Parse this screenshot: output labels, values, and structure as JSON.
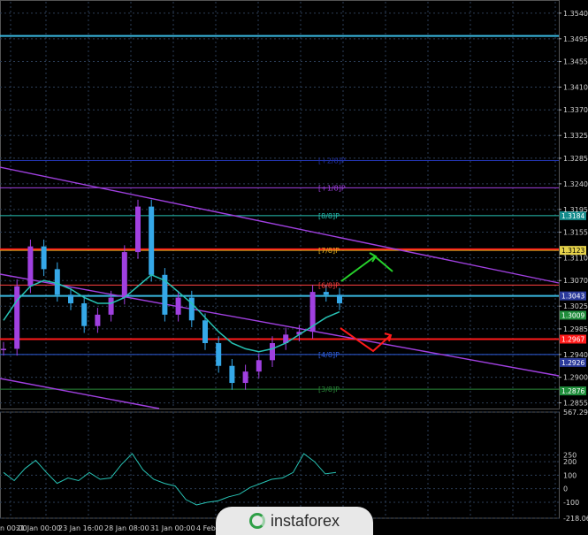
{
  "watermark": {
    "text": "instaforex"
  },
  "colors": {
    "bg": "#000000",
    "grid": "#2c3e57",
    "candle": "#35a8e8",
    "candle_bull": "#a040e0",
    "ma": "#27c2b4",
    "channel": "#a040e0",
    "red_level": "#ff1a1a",
    "cyan_level": "#39b8e0",
    "lbl_bg_blue": "#2b3a9b",
    "lbl_bg_red": "#ff1a1a",
    "lbl_bg_yellow": "#e6d24a",
    "lbl_bg_green": "#1f8d3b",
    "lbl_bg_purple": "#7b2fb0",
    "lbl_bg_teal": "#138c8c",
    "cci": "#27c2b4",
    "arrow_up": "#26d12b",
    "arrow_down": "#ff1a1a"
  },
  "chart_data": [
    {
      "type": "line",
      "title": "",
      "x_ticks": [
        "20 Jan 00:00",
        "21 Jan 00:00",
        "23 Jan 16:00",
        "28 Jan 08:00",
        "31 Jan 00:00",
        "4 Feb"
      ],
      "y_ticks": [
        "1.3540",
        "1.3495",
        "1.3455",
        "1.3410",
        "1.3370",
        "1.3325",
        "1.3285",
        "1.3240",
        "1.3195",
        "1.3155",
        "1.3110",
        "1.3070",
        "1.3025",
        "1.2985",
        "1.2940",
        "1.2900",
        "1.2855"
      ],
      "ylim": [
        1.2845,
        1.356
      ],
      "series": [
        {
          "values": [
            1.295,
            1.306,
            1.313,
            1.309,
            1.3045,
            1.303,
            1.299,
            1.301,
            1.304,
            1.312,
            1.32,
            1.308,
            1.301,
            1.304,
            1.3,
            1.296,
            1.292,
            1.289,
            1.291,
            1.293,
            1.296,
            1.2975,
            1.298,
            1.305,
            1.3045,
            1.303
          ]
        },
        {
          "values": [
            1.3,
            1.3035,
            1.306,
            1.307,
            1.3065,
            1.3055,
            1.304,
            1.303,
            1.303,
            1.304,
            1.306,
            1.308,
            1.307,
            1.305,
            1.303,
            1.3005,
            1.298,
            1.296,
            1.295,
            1.2945,
            1.295,
            1.296,
            1.2975,
            1.299,
            1.3005,
            1.3015
          ]
        }
      ],
      "price_labels": [
        "1.3043",
        "1.3184",
        "1.3123",
        "1.2967",
        "1.3009",
        "1.2926",
        "1.2876"
      ],
      "murrey_labels": [
        "[8/8]P",
        "[7/8]P",
        "[6/8]P",
        "[4/8]P",
        "[3/8]P",
        "[+1/8]P",
        "[+2/8]P"
      ],
      "levels": [
        {
          "label": "[+2/8]P",
          "value": 1.3281
        },
        {
          "label": "[+1/8]P",
          "value": 1.3233
        },
        {
          "label": "[8/8]P",
          "value": 1.3184
        },
        {
          "label": "[7/8]P",
          "value": 1.3123
        },
        {
          "label": "[6/8]P",
          "value": 1.3062
        },
        {
          "label": "[4/8]P",
          "value": 1.294
        },
        {
          "label": "[3/8]P",
          "value": 1.2879
        }
      ],
      "horizontal_lines": [
        1.35,
        1.3125,
        1.3043,
        1.2967
      ]
    },
    {
      "type": "line",
      "title": "",
      "y_ticks": [
        "567.2935",
        "250",
        "200",
        "100",
        "0",
        "-100",
        "-218.0641"
      ],
      "ylim": [
        -218.0641,
        567.2935
      ],
      "series": [
        {
          "values": [
            120,
            60,
            150,
            210,
            120,
            40,
            80,
            60,
            120,
            70,
            80,
            180,
            260,
            140,
            70,
            40,
            20,
            -80,
            -120,
            -100,
            -90,
            -60,
            -40,
            10,
            40,
            70,
            80,
            120,
            260,
            200,
            110,
            120
          ]
        }
      ]
    }
  ]
}
